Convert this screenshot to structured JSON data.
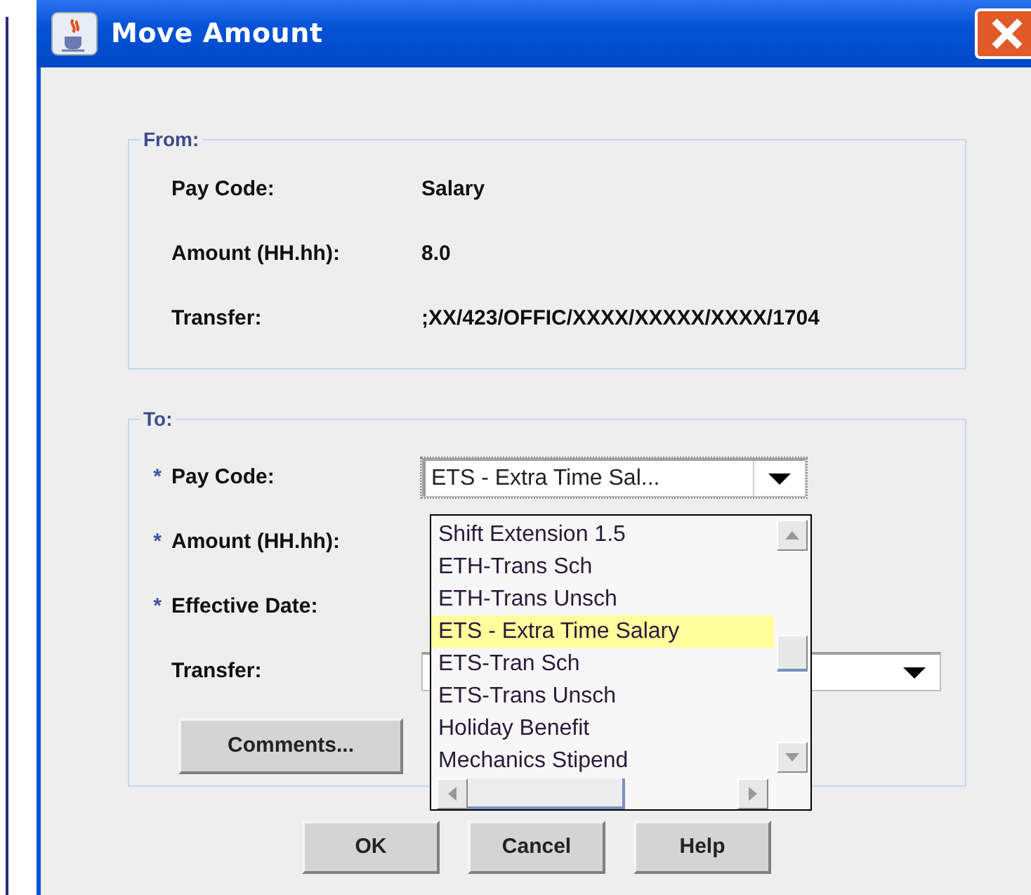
{
  "window": {
    "title": "Move Amount"
  },
  "from": {
    "legend": "From:",
    "rows": [
      {
        "label": "Pay Code:",
        "value": "Salary"
      },
      {
        "label": "Amount (HH.hh):",
        "value": "8.0"
      },
      {
        "label": "Transfer:",
        "value": ";XX/423/OFFIC/XXXX/XXXXX/XXXX/1704"
      }
    ]
  },
  "to": {
    "legend": "To:",
    "fields": [
      {
        "marker": "*",
        "label": "Pay Code:",
        "kind": "combo",
        "value": "ETS - Extra Time Sal...",
        "expanded": true
      },
      {
        "marker": "*",
        "label": "Amount (HH.hh):",
        "kind": "covered"
      },
      {
        "marker": "*",
        "label": "Effective Date:",
        "kind": "covered"
      },
      {
        "label": "Transfer:",
        "kind": "combo",
        "expanded": false
      }
    ],
    "comments_button": "Comments..."
  },
  "dropdown": {
    "items": [
      {
        "label": "Shift Extension 1.5",
        "selected": false
      },
      {
        "label": "ETH-Trans Sch",
        "selected": false
      },
      {
        "label": "ETH-Trans Unsch",
        "selected": false
      },
      {
        "label": "ETS - Extra Time Salary",
        "selected": true
      },
      {
        "label": "ETS-Tran Sch",
        "selected": false
      },
      {
        "label": "ETS-Trans Unsch",
        "selected": false
      },
      {
        "label": "Holiday Benefit",
        "selected": false
      },
      {
        "label": "Mechanics Stipend",
        "selected": false
      }
    ]
  },
  "buttons": [
    "OK",
    "Cancel",
    "Help"
  ]
}
